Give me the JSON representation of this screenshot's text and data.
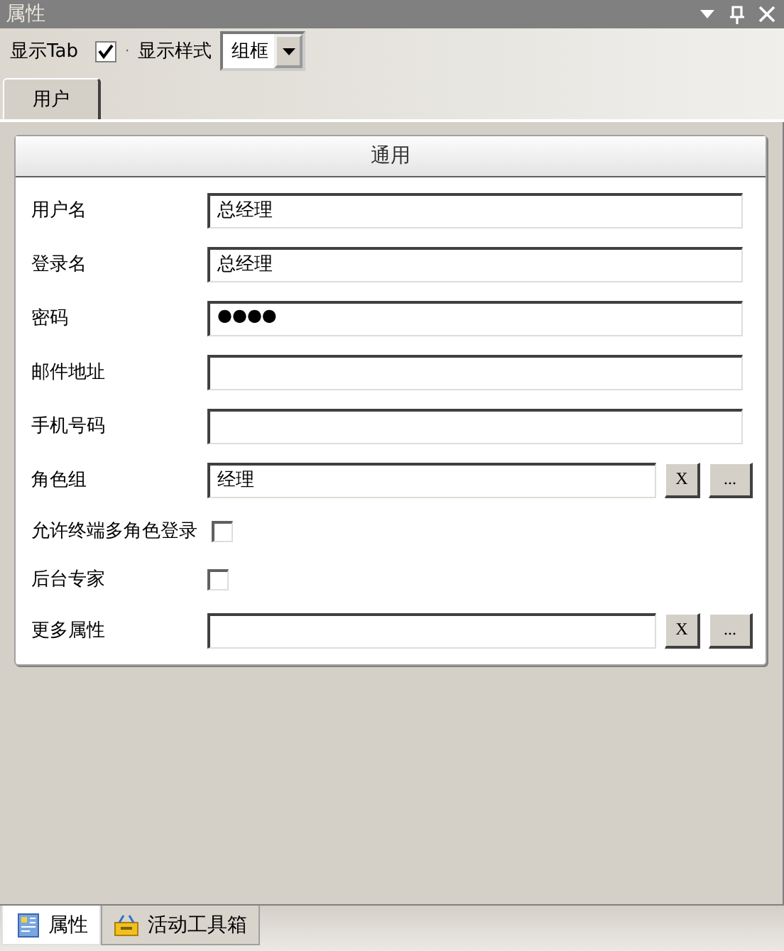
{
  "window": {
    "title": "属性"
  },
  "toolbar": {
    "show_tab_label": "显示Tab",
    "show_tab_checked": true,
    "separator": "·",
    "style_label": "显示样式",
    "style_value": "组框"
  },
  "tabs": [
    {
      "label": "用户",
      "selected": true
    }
  ],
  "group": {
    "title": "通用"
  },
  "fields": [
    {
      "kind": "text",
      "label": "用户名",
      "value": "总经理"
    },
    {
      "kind": "text",
      "label": "登录名",
      "value": "总经理"
    },
    {
      "kind": "password",
      "label": "密码",
      "value": "●●●●"
    },
    {
      "kind": "text",
      "label": "邮件地址"
    },
    {
      "kind": "text",
      "label": "手机号码"
    },
    {
      "kind": "picker",
      "label": "角色组",
      "value": "经理",
      "clear": "X",
      "browse": "..."
    },
    {
      "kind": "checkbox",
      "label": "允许终端多角色登录",
      "checked": false
    },
    {
      "kind": "checkbox",
      "label": "后台专家",
      "checked": false
    },
    {
      "kind": "picker",
      "label": "更多属性",
      "clear": "X",
      "browse": "..."
    }
  ],
  "bottom_tabs": [
    {
      "label": "属性",
      "kind": "properties",
      "selected": true
    },
    {
      "label": "活动工具箱",
      "kind": "toolbox",
      "selected": false
    }
  ]
}
